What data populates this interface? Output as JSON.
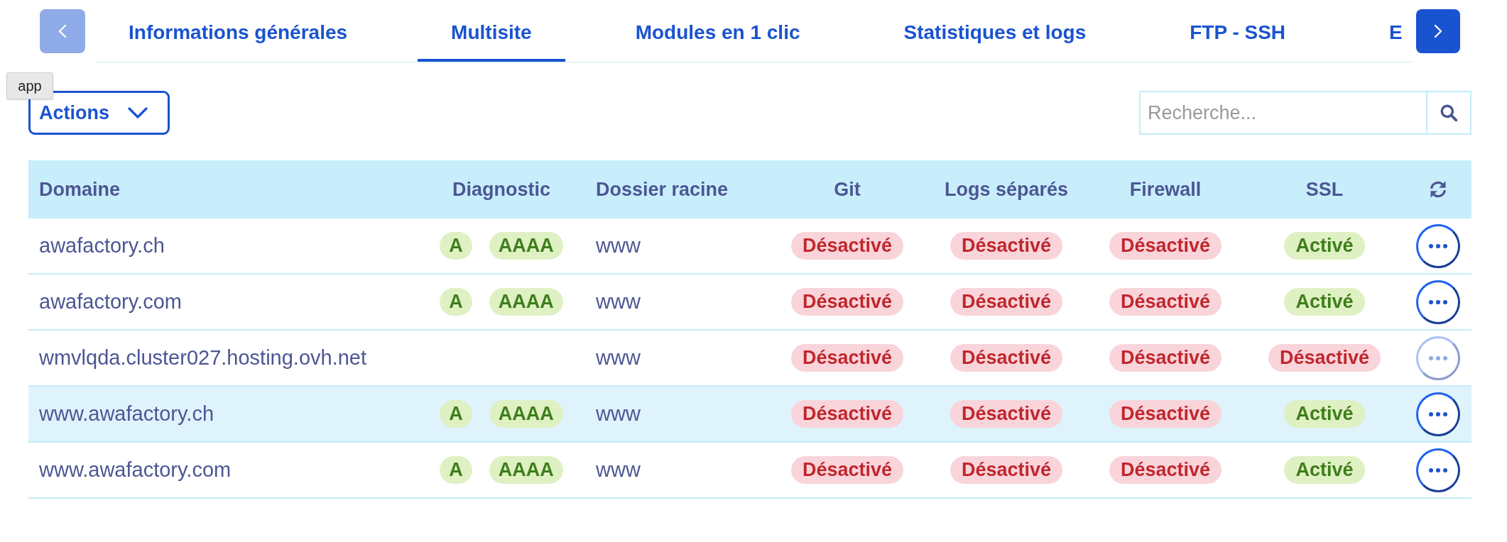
{
  "tabs": {
    "previous_button": {
      "disabled": true
    },
    "items": [
      {
        "label": "Informations générales",
        "selected": false
      },
      {
        "label": "Multisite",
        "selected": true
      },
      {
        "label": "Modules en 1 clic",
        "selected": false
      },
      {
        "label": "Statistiques et logs",
        "selected": false
      },
      {
        "label": "FTP - SSH",
        "selected": false
      },
      {
        "label": "E",
        "selected": false
      }
    ],
    "next_button": {
      "disabled": false
    }
  },
  "tooltip": {
    "text": "app"
  },
  "toolbar": {
    "actions_button": {
      "label": "Actions"
    },
    "search": {
      "placeholder": "Recherche..."
    }
  },
  "table": {
    "columns": [
      "Domaine",
      "Diagnostic",
      "Dossier racine",
      "Git",
      "Logs séparés",
      "Firewall",
      "SSL"
    ],
    "rows": [
      {
        "domain": "awafactory.ch",
        "diagnostic": [
          "A",
          "AAAA"
        ],
        "folder": "www",
        "statuses": [
          {
            "label": "Désactivé",
            "on": false
          },
          {
            "label": "Désactivé",
            "on": false
          },
          {
            "label": "Désactivé",
            "on": false
          },
          {
            "label": "Activé",
            "on": true
          }
        ],
        "menu_disabled": false,
        "highlighted": false
      },
      {
        "domain": "awafactory.com",
        "diagnostic": [
          "A",
          "AAAA"
        ],
        "folder": "www",
        "statuses": [
          {
            "label": "Désactivé",
            "on": false
          },
          {
            "label": "Désactivé",
            "on": false
          },
          {
            "label": "Désactivé",
            "on": false
          },
          {
            "label": "Activé",
            "on": true
          }
        ],
        "menu_disabled": false,
        "highlighted": false
      },
      {
        "domain": "wmvlqda.cluster027.hosting.ovh.net",
        "folder": "www",
        "statuses": [
          {
            "label": "Désactivé",
            "on": false
          },
          {
            "label": "Désactivé",
            "on": false
          },
          {
            "label": "Désactivé",
            "on": false
          },
          {
            "label": "Désactivé",
            "on": false
          }
        ],
        "menu_disabled": true,
        "highlighted": false
      },
      {
        "domain": "www.awafactory.ch",
        "diagnostic": [
          "A",
          "AAAA"
        ],
        "folder": "www",
        "statuses": [
          {
            "label": "Désactivé",
            "on": false
          },
          {
            "label": "Désactivé",
            "on": false
          },
          {
            "label": "Désactivé",
            "on": false
          },
          {
            "label": "Activé",
            "on": true
          }
        ],
        "menu_disabled": false,
        "highlighted": true
      },
      {
        "domain": "www.awafactory.com",
        "diagnostic": [
          "A",
          "AAAA"
        ],
        "folder": "www",
        "statuses": [
          {
            "label": "Désactivé",
            "on": false
          },
          {
            "label": "Désactivé",
            "on": false
          },
          {
            "label": "Désactivé",
            "on": false
          },
          {
            "label": "Activé",
            "on": true
          }
        ],
        "menu_disabled": false,
        "highlighted": false
      }
    ]
  }
}
